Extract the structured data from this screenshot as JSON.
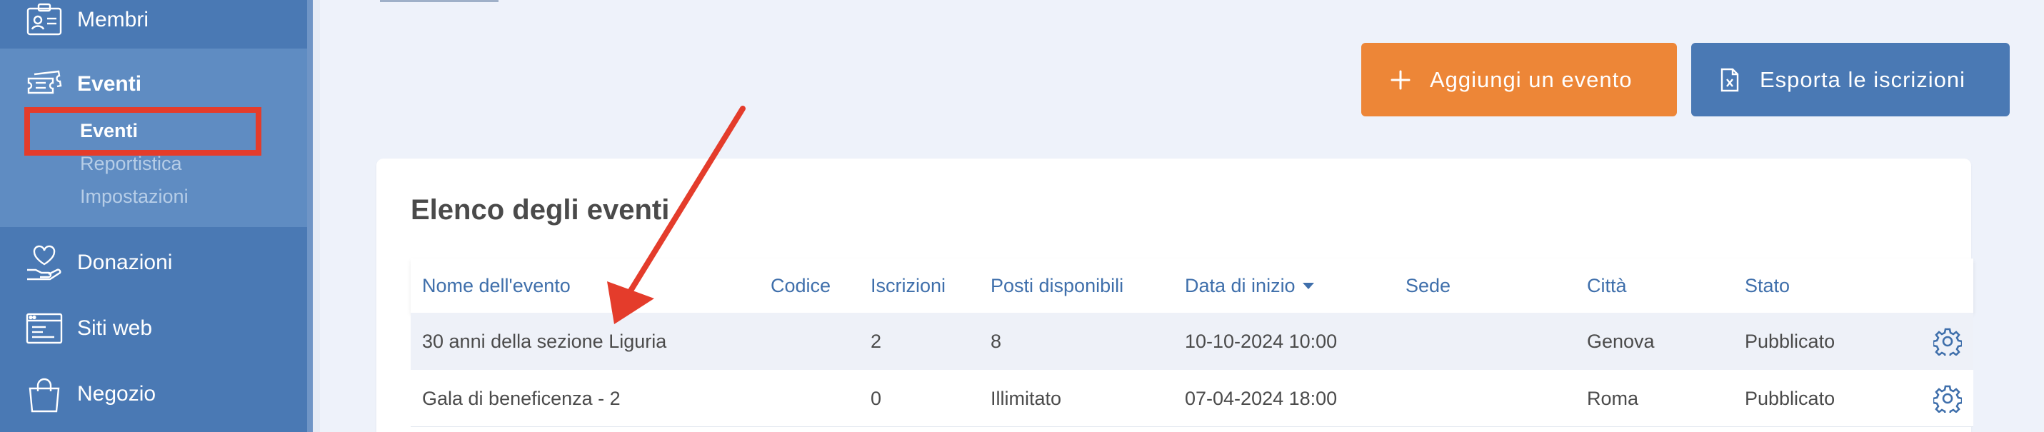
{
  "sidebar": {
    "items": [
      {
        "label": "Membri",
        "icon": "member-card-icon"
      },
      {
        "label": "Eventi",
        "icon": "tickets-icon"
      },
      {
        "label": "Donazioni",
        "icon": "heart-hand-icon"
      },
      {
        "label": "Siti web",
        "icon": "website-icon"
      },
      {
        "label": "Negozio",
        "icon": "shopping-bag-icon"
      }
    ],
    "sub_items": [
      {
        "label": "Eventi",
        "active": true
      },
      {
        "label": "Reportistica",
        "active": false
      },
      {
        "label": "Impostazioni",
        "active": false
      }
    ]
  },
  "toolbar": {
    "add_label": "Aggiungi un evento",
    "add_icon": "plus-icon",
    "export_label": "Esporta le iscrizioni",
    "export_icon": "excel-file-icon"
  },
  "events": {
    "title": "Elenco degli eventi",
    "columns": [
      "Nome dell'evento",
      "Codice",
      "Iscrizioni",
      "Posti disponibili",
      "Data di inizio",
      "Sede",
      "Città",
      "Stato"
    ],
    "sorted_column": "Data di inizio",
    "rows": [
      {
        "name": "30 anni della sezione Liguria",
        "code": "",
        "registrations": "2",
        "seats": "8",
        "start": "10-10-2024 10:00",
        "venue": "",
        "city": "Genova",
        "status": "Pubblicato"
      },
      {
        "name": "Gala di beneficenza - 2",
        "code": "",
        "registrations": "0",
        "seats": "Illimitato",
        "start": "07-04-2024 18:00",
        "venue": "",
        "city": "Roma",
        "status": "Pubblicato"
      }
    ]
  },
  "colors": {
    "sidebar": "#4a79b4",
    "sidebar_active": "#5f8cc2",
    "accent_orange": "#ed8637",
    "primary_blue": "#4a79b4",
    "annotation_red": "#e43c2b"
  }
}
